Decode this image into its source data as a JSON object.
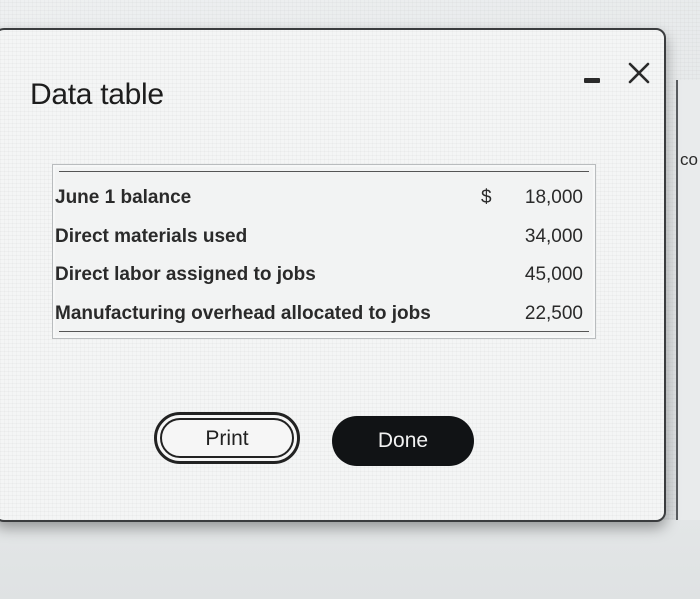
{
  "dialog": {
    "title": "Data table",
    "controls": {
      "minimize_icon": "minimize-icon",
      "close_icon": "close-icon"
    }
  },
  "table": {
    "currency_symbol": "$",
    "rows": [
      {
        "label": "June 1 balance",
        "currency": "$",
        "value": "18,000"
      },
      {
        "label": "Direct materials used",
        "currency": "",
        "value": "34,000"
      },
      {
        "label": "Direct labor assigned to jobs",
        "currency": "",
        "value": "45,000"
      },
      {
        "label": "Manufacturing overhead allocated to jobs",
        "currency": "",
        "value": "22,500"
      }
    ]
  },
  "buttons": {
    "print_label": "Print",
    "done_label": "Done"
  },
  "background": {
    "fragment_text": "co"
  },
  "colors": {
    "done_button_bg": "#111315",
    "dialog_bg": "#f4f5f5",
    "text": "#2a2a2a"
  }
}
